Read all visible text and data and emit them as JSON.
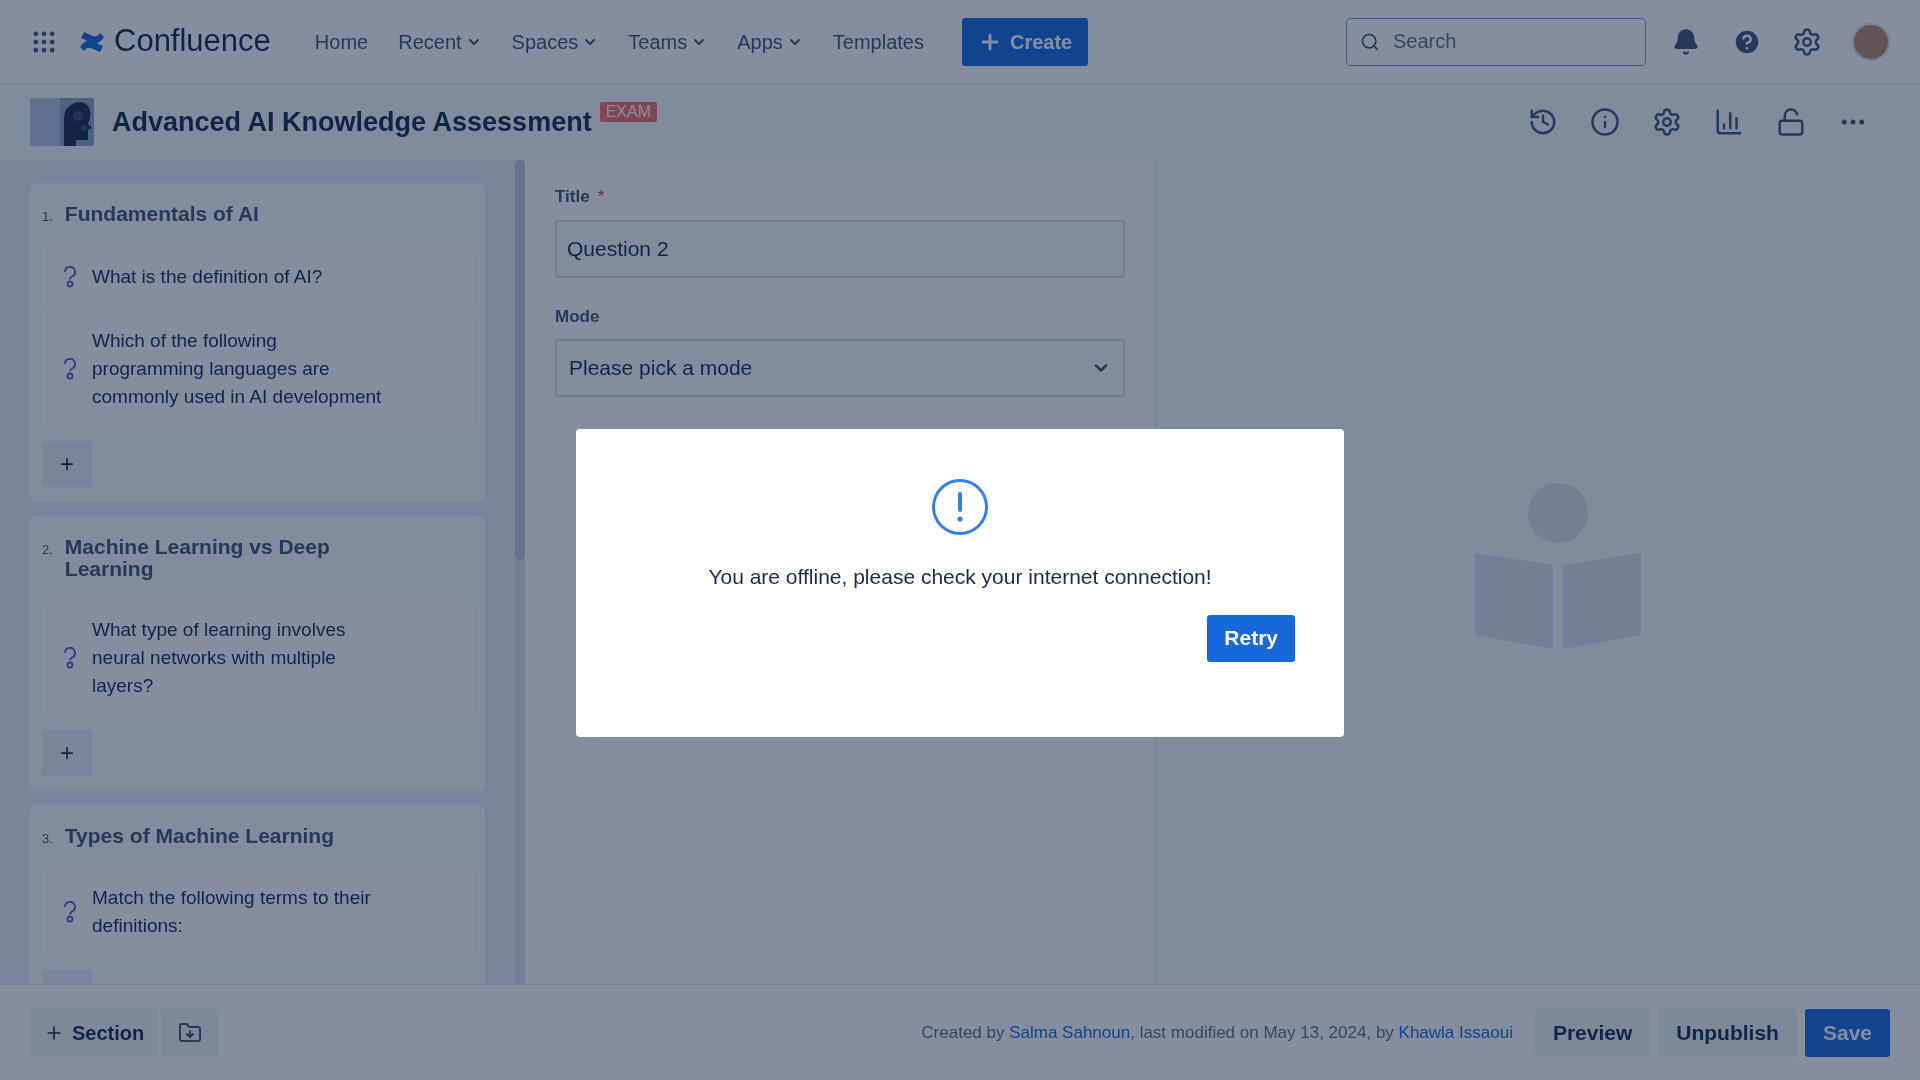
{
  "app": {
    "name": "Confluence"
  },
  "nav": [
    {
      "label": "Home",
      "dropdown": false
    },
    {
      "label": "Recent",
      "dropdown": true
    },
    {
      "label": "Spaces",
      "dropdown": true
    },
    {
      "label": "Teams",
      "dropdown": true
    },
    {
      "label": "Apps",
      "dropdown": true
    },
    {
      "label": "Templates",
      "dropdown": false
    }
  ],
  "create_button": "Create",
  "search": {
    "placeholder": "Search"
  },
  "page_header": {
    "title": "Advanced AI Knowledge Assessment",
    "badge": "EXAM"
  },
  "sections": [
    {
      "number": "1.",
      "title": "Fundamentals of AI",
      "questions": [
        "What is the definition of AI?",
        "Which of the following programming languages are commonly used in AI development"
      ]
    },
    {
      "number": "2.",
      "title": "Machine Learning vs Deep Learning",
      "questions": [
        "What type of learning involves neural networks with multiple layers?"
      ]
    },
    {
      "number": "3.",
      "title": "Types of Machine Learning",
      "questions": [
        "Match the following terms to their definitions:"
      ]
    }
  ],
  "add_button": "+",
  "form": {
    "title_label": "Title",
    "required_mark": "*",
    "title_value": "Question 2",
    "mode_label": "Mode",
    "mode_placeholder": "Please pick a mode"
  },
  "dialog": {
    "message": "You are offline, please check your internet connection!",
    "button": "Retry"
  },
  "footer": {
    "section_button": "Section",
    "byline": [
      {
        "kind": "text",
        "text": "Created by "
      },
      {
        "kind": "link",
        "text": "Salma Sahnoun"
      },
      {
        "kind": "text",
        "text": ", last modified on May 13, 2024, by "
      },
      {
        "kind": "link",
        "text": "Khawla Issaoui"
      }
    ],
    "buttons": [
      {
        "label": "Preview",
        "primary": false
      },
      {
        "label": "Unpublish",
        "primary": false
      },
      {
        "label": "Save",
        "primary": true
      }
    ]
  }
}
